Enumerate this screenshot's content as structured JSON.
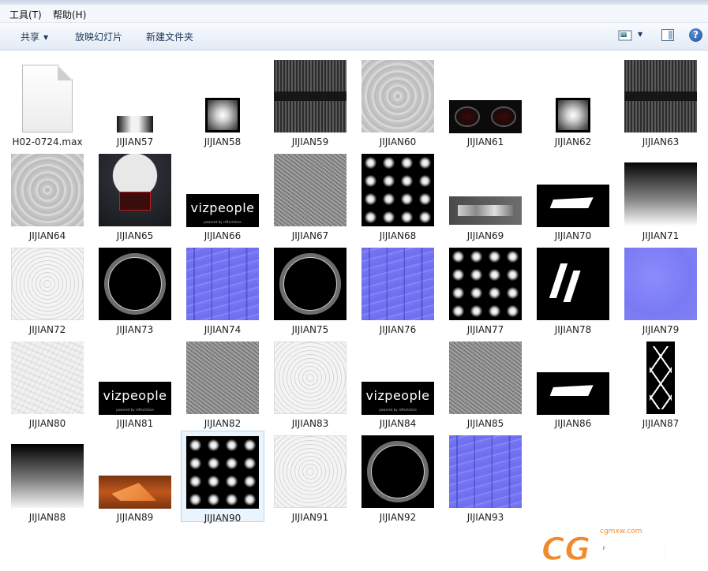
{
  "menubar": {
    "items": [
      "工具(T)",
      "帮助(H)"
    ]
  },
  "toolbar": {
    "share": "共享",
    "slideshow": "放映幻灯片",
    "new_folder": "新建文件夹",
    "help": "?"
  },
  "viz_text": {
    "brand": "vizpeople",
    "sub": "powered by reflectstore"
  },
  "files": [
    {
      "name": "H02-0724.max",
      "thumb": "doc-icon"
    },
    {
      "name": "JIJIAN57",
      "thumb": "gradient-strip"
    },
    {
      "name": "JIJIAN58",
      "thumb": "pyramid-gradient"
    },
    {
      "name": "JIJIAN59",
      "thumb": "tread-dark"
    },
    {
      "name": "JIJIAN60",
      "thumb": "ripple-gray"
    },
    {
      "name": "JIJIAN61",
      "thumb": "dashboard"
    },
    {
      "name": "JIJIAN62",
      "thumb": "pyramid-gradient"
    },
    {
      "name": "JIJIAN63",
      "thumb": "tread-dark"
    },
    {
      "name": "JIJIAN64",
      "thumb": "ripple-gray"
    },
    {
      "name": "JIJIAN65",
      "thumb": "gauge"
    },
    {
      "name": "JIJIAN66",
      "thumb": "vizpeople"
    },
    {
      "name": "JIJIAN67",
      "thumb": "noise"
    },
    {
      "name": "JIJIAN68",
      "thumb": "light-grid"
    },
    {
      "name": "JIJIAN69",
      "thumb": "car-strip"
    },
    {
      "name": "JIJIAN70",
      "thumb": "white-wedge"
    },
    {
      "name": "JIJIAN71",
      "thumb": "vertical-gradient"
    },
    {
      "name": "JIJIAN72",
      "thumb": "rings"
    },
    {
      "name": "JIJIAN73",
      "thumb": "tire"
    },
    {
      "name": "JIJIAN74",
      "thumb": "normal-tread"
    },
    {
      "name": "JIJIAN75",
      "thumb": "tire"
    },
    {
      "name": "JIJIAN76",
      "thumb": "normal-tread"
    },
    {
      "name": "JIJIAN77",
      "thumb": "light-grid"
    },
    {
      "name": "JIJIAN78",
      "thumb": "slashes"
    },
    {
      "name": "JIJIAN79",
      "thumb": "normal-blue"
    },
    {
      "name": "JIJIAN80",
      "thumb": "plaster"
    },
    {
      "name": "JIJIAN81",
      "thumb": "vizpeople"
    },
    {
      "name": "JIJIAN82",
      "thumb": "noise"
    },
    {
      "name": "JIJIAN83",
      "thumb": "rings"
    },
    {
      "name": "JIJIAN84",
      "thumb": "vizpeople"
    },
    {
      "name": "JIJIAN85",
      "thumb": "noise"
    },
    {
      "name": "JIJIAN86",
      "thumb": "white-wedge"
    },
    {
      "name": "JIJIAN87",
      "thumb": "lace"
    },
    {
      "name": "JIJIAN88",
      "thumb": "vertical-gradient"
    },
    {
      "name": "JIJIAN89",
      "thumb": "orange-shape"
    },
    {
      "name": "JIJIAN90",
      "thumb": "light-grid",
      "selected": true
    },
    {
      "name": "JIJIAN91",
      "thumb": "rings"
    },
    {
      "name": "JIJIAN92",
      "thumb": "tire"
    },
    {
      "name": "JIJIAN93",
      "thumb": "normal-tread"
    }
  ],
  "watermark": {
    "text": "CG模型王",
    "url": "cgmxw.com"
  },
  "colors": {
    "selection_bg": "#eaf4fd",
    "selection_border": "#b9d5ee",
    "toolbar_text": "#1e395b"
  }
}
